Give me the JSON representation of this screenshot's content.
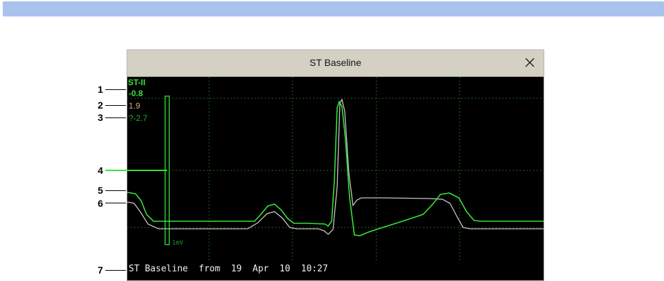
{
  "window": {
    "title": "ST Baseline",
    "close_icon": "close-icon"
  },
  "lead": {
    "name": "ST-II",
    "current_value": "-0.8",
    "baseline_value": "1.9",
    "difference_value": "?-2.7"
  },
  "scale_label": "1mV",
  "footer": "ST Baseline  from  19  Apr  10  10:27",
  "callouts": [
    "1",
    "2",
    "3",
    "4",
    "5",
    "6",
    "7"
  ],
  "colors": {
    "current_wave": "#35e43a",
    "baseline_wave": "#c8c8c8",
    "baseline_value": "#d9a86a",
    "difference_value": "#27a83a",
    "header_bar": "#a9c3ee"
  }
}
